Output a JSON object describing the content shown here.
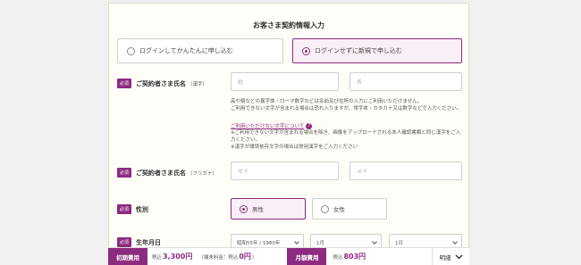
{
  "form": {
    "title": "お客さま契約情報入力",
    "options": [
      {
        "label": "ログインしてかんたんに申し込む",
        "selected": false
      },
      {
        "label": "ログインせずに新規で申し込む",
        "selected": true
      }
    ],
    "required_badge": "必須",
    "name_kanji": {
      "label": "ご契約者さま氏名",
      "hint": "（漢字）",
      "last_placeholder": "姓",
      "first_placeholder": "名"
    },
    "notes": {
      "line1": "高や崎などの異字体・ローマ数字などは名前及び住所の入力にご利用いただけません。",
      "line2": "ご利用できない文字が含まれる場合は恐れ入りますが、常字体・カタカナ又は数字などで入力ください。",
      "link": "ご利用いただけない文字について",
      "line3": "※ご利用できない文字が含まれる場合を除き、画像をアップロードされる本人確認書類と同じ漢字をご入力ください。",
      "line4": "※漢字が環境依存文字の場合は常用漢字をご入力ください"
    },
    "name_kana": {
      "label": "ご契約者さま氏名",
      "hint": "（フリガナ）",
      "last_placeholder": "セイ",
      "first_placeholder": "メイ"
    },
    "gender": {
      "label": "性別",
      "male": "男性",
      "female": "女性",
      "selected": "male"
    },
    "birthdate": {
      "label": "生年月日",
      "year": "昭和55年 / 1980年",
      "month": "1月",
      "day": "1日"
    }
  },
  "footer": {
    "initial_label": "初期費用",
    "tax_in": "税込",
    "initial_price": "3,300円",
    "terminal_note": "（端末料金：税込",
    "terminal_price": "0円",
    "terminal_close": "）",
    "monthly_label": "月額費用",
    "monthly_tax": "税込",
    "monthly_price": "803円",
    "detail": "明細"
  },
  "colors": {
    "accent": "#8c2b80",
    "card_bg": "#fffdf7",
    "page_bg": "#f0f0f0"
  }
}
